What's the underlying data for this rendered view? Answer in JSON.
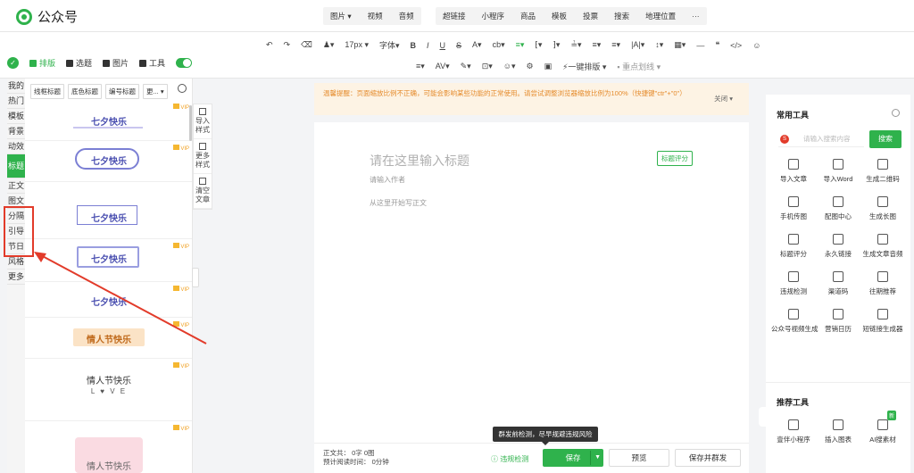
{
  "app": {
    "title": "公众号"
  },
  "insert_menu": {
    "group1": [
      "图片 ▾",
      "视频",
      "音频"
    ],
    "group2": [
      "超链接",
      "小程序",
      "商品",
      "模板",
      "投票",
      "搜索",
      "地理位置",
      "···"
    ]
  },
  "format_toolbar": {
    "row1": [
      "↶",
      "↷",
      "⌫",
      "♟▾",
      "17px ▾",
      "字体▾",
      "B",
      "I",
      "U",
      "S",
      "A▾",
      "cb▾",
      "≡▾",
      "⁅▾",
      "⁆▾",
      "≟▾",
      "≡▾",
      "≡▾",
      "|A|▾",
      "↕▾",
      "▦▾",
      "—",
      "❝",
      "</>",
      "☺"
    ],
    "row2": [
      "≡▾",
      "AV▾",
      "✎▾",
      "⊡▾",
      "☺▾",
      "⚙",
      "▣",
      "⚡一键排版 ▾",
      "▪ 重点划线 ▾"
    ]
  },
  "mode_tabs": [
    {
      "label": "排版",
      "active": true
    },
    {
      "label": "选题",
      "active": false
    },
    {
      "label": "图片",
      "active": false
    },
    {
      "label": "工具",
      "active": false
    }
  ],
  "left_nav": [
    {
      "label": "我的",
      "active": false
    },
    {
      "label": "热门",
      "active": false
    },
    {
      "label": "模板",
      "active": false
    },
    {
      "label": "背景",
      "active": false
    },
    {
      "label": "动效",
      "active": false
    },
    {
      "label": "标题",
      "active": true
    },
    {
      "label": "正文",
      "active": false
    },
    {
      "label": "图文",
      "active": false
    },
    {
      "label": "分隔",
      "active": false
    },
    {
      "label": "引导",
      "active": false
    },
    {
      "label": "节日",
      "active": false
    },
    {
      "label": "风格",
      "active": false
    },
    {
      "label": "更多",
      "active": false
    }
  ],
  "filter_chips": [
    "线框标题",
    "底色标题",
    "编号标题",
    "更... ▾"
  ],
  "style_cards": [
    {
      "text": "七夕快乐",
      "vip": "VIP"
    },
    {
      "text": "七夕快乐",
      "vip": "VIP"
    },
    {
      "text": "七夕快乐",
      "vip": ""
    },
    {
      "text": "七夕快乐",
      "vip": "VIP"
    },
    {
      "text": "七夕快乐",
      "vip": "VIP"
    },
    {
      "text": "情人节快乐",
      "vip": "VIP"
    },
    {
      "text": "情人节快乐",
      "vip": "VIP",
      "sub": "L ♥ V E"
    },
    {
      "text": "情人节快乐",
      "vip": "VIP"
    }
  ],
  "side_tools": [
    {
      "label": "导入样式"
    },
    {
      "label": "更多样式"
    },
    {
      "label": "清空文章"
    }
  ],
  "warning": {
    "text": "温馨提醒：页面缩放比例不正确，可能会影响某些功能的正常使用。请尝试调整浏览器缩放比例为100%（快捷键\"ctr\"+\"0\"）",
    "close_label": "关闭 ▾"
  },
  "editor": {
    "title_placeholder": "请在这里输入标题",
    "score_button": "标题评分",
    "author_placeholder": "请输入作者",
    "body_placeholder": "从这里开始写正文"
  },
  "bottom": {
    "word_count": "正文共：  0字 0图",
    "read_time": "预计阅读时间：  0分钟",
    "check_label": "ⓘ 违规检测",
    "save": "保存",
    "preview": "预览",
    "send": "保存并群发",
    "tooltip": "群发前检测，尽早规避违规风险"
  },
  "right_panel": {
    "common_title": "常用工具",
    "search_placeholder": "请输入搜索内容",
    "search_button": "搜索",
    "tools": [
      "导入文章",
      "导入Word",
      "生成二维码",
      "手机传图",
      "配图中心",
      "生成长图",
      "标题评分",
      "永久链接",
      "生成文章音频",
      "违规检测",
      "渠道码",
      "往期推荐",
      "公众号视频生成",
      "营销日历",
      "短链接生成器"
    ],
    "recommend_title": "推荐工具",
    "recommend_tools": [
      "壹伴小程序",
      "插入图表",
      "AI搜素材"
    ],
    "new_badge": "新"
  },
  "colors": {
    "accent": "#2fb24c",
    "annotation": "#e23b2a",
    "warning_bg": "#fdf3e4"
  }
}
